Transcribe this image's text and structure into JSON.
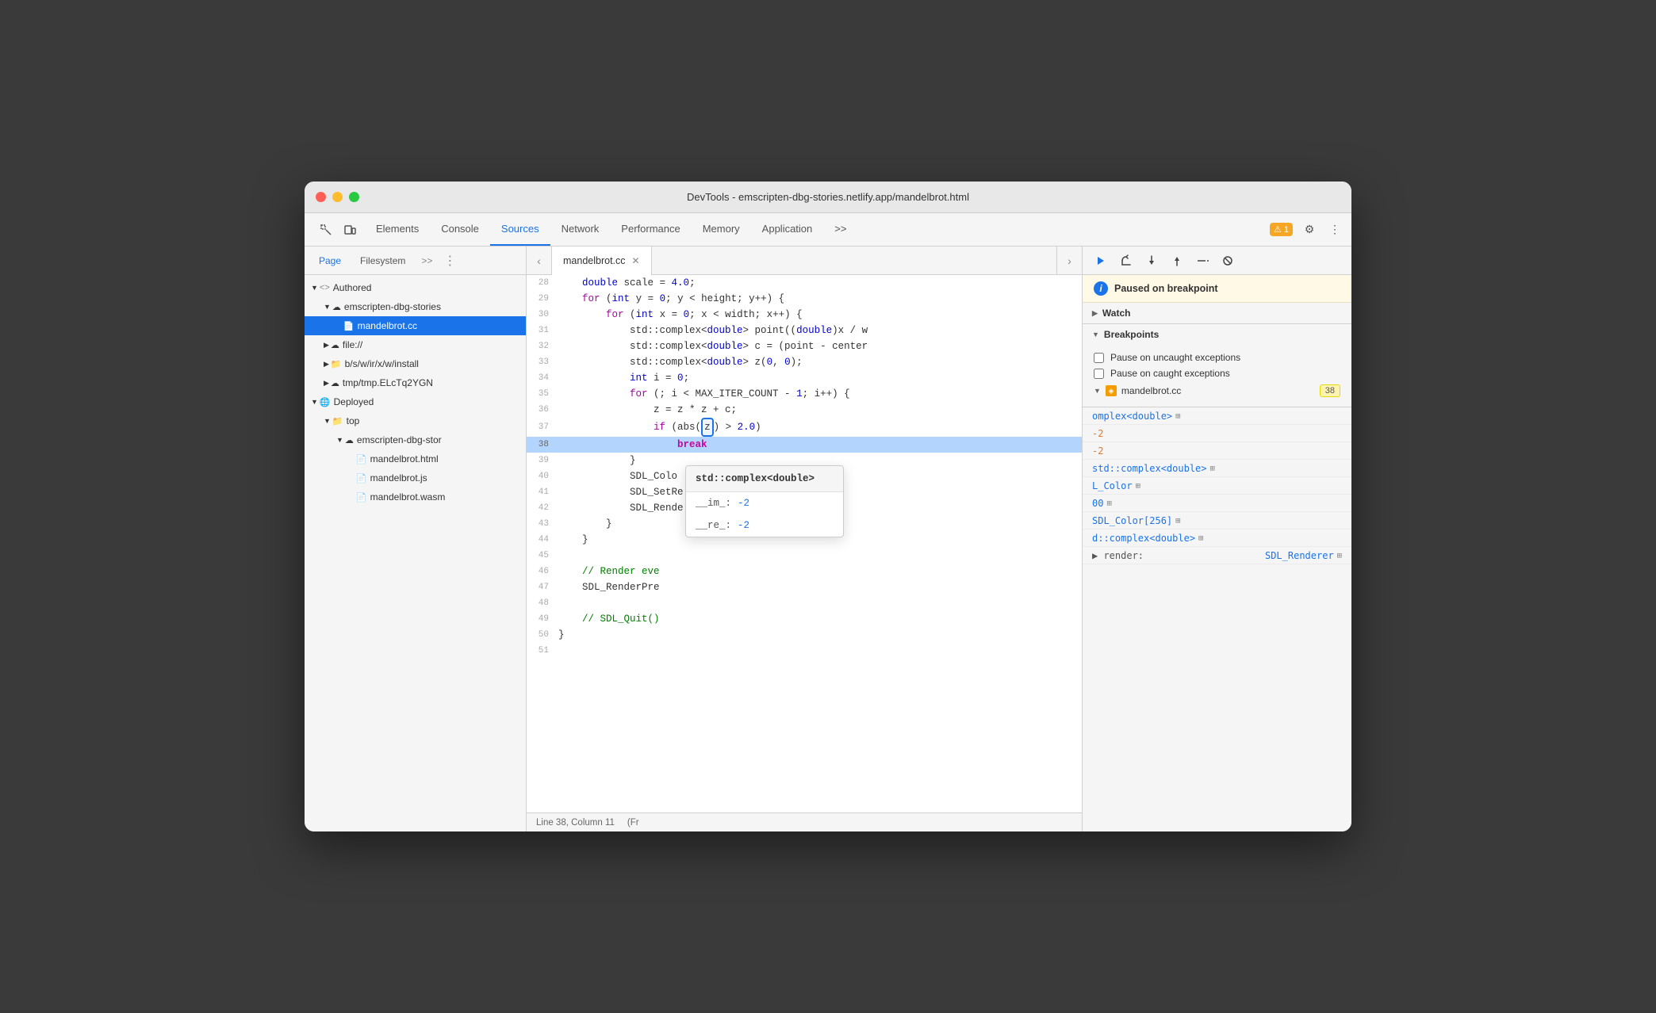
{
  "window": {
    "title": "DevTools - emscripten-dbg-stories.netlify.app/mandelbrot.html"
  },
  "tabs": {
    "items": [
      "Elements",
      "Console",
      "Sources",
      "Network",
      "Performance",
      "Memory",
      "Application"
    ],
    "active": "Sources",
    "more_label": ">>",
    "warning_count": "1"
  },
  "left_panel": {
    "tabs": [
      "Page",
      "Filesystem"
    ],
    "more": ">>",
    "dots": "⋮",
    "tree": [
      {
        "id": "authored",
        "label": "Authored",
        "indent": 0,
        "type": "group",
        "expanded": true
      },
      {
        "id": "emscripten1",
        "label": "emscripten-dbg-stories",
        "indent": 1,
        "type": "cloud",
        "expanded": true
      },
      {
        "id": "mandelbrot_cc",
        "label": "mandelbrot.cc",
        "indent": 2,
        "type": "file",
        "selected": true
      },
      {
        "id": "file",
        "label": "file://",
        "indent": 1,
        "type": "cloud",
        "expanded": false
      },
      {
        "id": "bswir",
        "label": "b/s/w/ir/x/w/install",
        "indent": 1,
        "type": "folder",
        "expanded": false
      },
      {
        "id": "tmp",
        "label": "tmp/tmp.ELcTq2YGN",
        "indent": 1,
        "type": "cloud",
        "expanded": false
      },
      {
        "id": "deployed",
        "label": "Deployed",
        "indent": 0,
        "type": "group",
        "expanded": true
      },
      {
        "id": "top",
        "label": "top",
        "indent": 1,
        "type": "folder",
        "expanded": true
      },
      {
        "id": "emscripten2",
        "label": "emscripten-dbg-stor",
        "indent": 2,
        "type": "cloud",
        "expanded": true
      },
      {
        "id": "mandelbrot_html",
        "label": "mandelbrot.html",
        "indent": 3,
        "type": "file",
        "selected": false
      },
      {
        "id": "mandelbrot_js",
        "label": "mandelbrot.js",
        "indent": 3,
        "type": "file",
        "selected": false
      },
      {
        "id": "mandelbrot_wasm",
        "label": "mandelbrot.wasm",
        "indent": 3,
        "type": "file",
        "selected": false
      }
    ]
  },
  "editor": {
    "filename": "mandelbrot.cc",
    "lines": [
      {
        "num": "28",
        "content": "    double scale = 4.0;",
        "highlight": false
      },
      {
        "num": "29",
        "content": "    for (int y = 0; y < height; y++) {",
        "highlight": false
      },
      {
        "num": "30",
        "content": "        for (int x = 0; x < width; x++) {",
        "highlight": false
      },
      {
        "num": "31",
        "content": "            std::complex<double> point((double)x / w",
        "highlight": false
      },
      {
        "num": "32",
        "content": "            std::complex<double> c = (point - center",
        "highlight": false
      },
      {
        "num": "33",
        "content": "            std::complex<double> z(0, 0);",
        "highlight": false
      },
      {
        "num": "34",
        "content": "            int i = 0;",
        "highlight": false
      },
      {
        "num": "35",
        "content": "            for (; i < MAX_ITER_COUNT - 1; i++) {",
        "highlight": false
      },
      {
        "num": "36",
        "content": "                z = z * z + c;",
        "highlight": false
      },
      {
        "num": "37",
        "content": "                if (abs([z]) > 2.0)",
        "highlight": false
      },
      {
        "num": "38",
        "content": "                    break",
        "highlight": true
      },
      {
        "num": "39",
        "content": "            }",
        "highlight": false
      },
      {
        "num": "40",
        "content": "            SDL_Colo",
        "highlight": false
      },
      {
        "num": "41",
        "content": "            SDL_SetRe",
        "highlight": false
      },
      {
        "num": "42",
        "content": "            SDL_Rende",
        "highlight": false
      },
      {
        "num": "43",
        "content": "        }",
        "highlight": false
      },
      {
        "num": "44",
        "content": "    }",
        "highlight": false
      },
      {
        "num": "45",
        "content": "",
        "highlight": false
      },
      {
        "num": "46",
        "content": "    // Render eve",
        "highlight": false
      },
      {
        "num": "47",
        "content": "    SDL_RenderPre",
        "highlight": false
      },
      {
        "num": "48",
        "content": "",
        "highlight": false
      },
      {
        "num": "49",
        "content": "    // SDL_Quit()",
        "highlight": false
      },
      {
        "num": "50",
        "content": "}",
        "highlight": false
      },
      {
        "num": "51",
        "content": "",
        "highlight": false
      }
    ],
    "status": "Line 38, Column 11",
    "status_extra": "(Fr"
  },
  "tooltip": {
    "title": "std::complex<double>",
    "rows": [
      {
        "key": "__im_:",
        "value": "-2"
      },
      {
        "key": "__re_:",
        "value": "-2"
      }
    ]
  },
  "right_panel": {
    "paused_label": "Paused on breakpoint",
    "watch_label": "Watch",
    "breakpoints_label": "Breakpoints",
    "pause_uncaught_label": "Pause on uncaught exceptions",
    "pause_caught_label": "Pause on caught exceptions",
    "bp_filename": "mandelbrot.cc",
    "bp_line": "38",
    "scope_rows": [
      {
        "key": "",
        "val": "omplex<double>",
        "type": "⊞",
        "indent": false
      },
      {
        "key": "",
        "val": "-2",
        "type": "",
        "indent": false
      },
      {
        "key": "",
        "val": "-2",
        "type": "",
        "indent": false
      },
      {
        "key": "",
        "val": "std::complex<double>",
        "type": "⊞",
        "indent": false
      },
      {
        "key": "",
        "val": "L_Color",
        "type": "⊞",
        "indent": false
      },
      {
        "key": "",
        "val": "00",
        "type": "⊞",
        "indent": false
      },
      {
        "key": "",
        "val": "SDL_Color[256]",
        "type": "⊞",
        "indent": false
      },
      {
        "key": "",
        "val": "d::complex<double>⊞",
        "type": "",
        "indent": false
      },
      {
        "key": "▶ render:",
        "val": "SDL_Renderer⊞",
        "type": "",
        "indent": false
      }
    ]
  }
}
